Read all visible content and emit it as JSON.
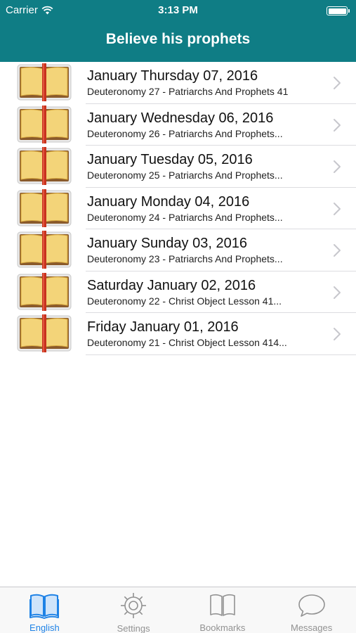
{
  "status_bar": {
    "carrier": "Carrier",
    "time": "3:13 PM"
  },
  "nav": {
    "title": "Believe his prophets"
  },
  "readings": [
    {
      "title": "January Thursday 07, 2016",
      "subtitle": "Deuteronomy 27  -  Patriarchs And Prophets 41"
    },
    {
      "title": "January Wednesday 06, 2016",
      "subtitle": "Deuteronomy 26  -  Patriarchs And Prophets..."
    },
    {
      "title": "January Tuesday 05, 2016",
      "subtitle": "Deuteronomy 25  -  Patriarchs And Prophets..."
    },
    {
      "title": "January Monday 04, 2016",
      "subtitle": "Deuteronomy 24  -  Patriarchs And Prophets..."
    },
    {
      "title": "January Sunday 03, 2016",
      "subtitle": "Deuteronomy 23  -  Patriarchs And Prophets..."
    },
    {
      "title": "Saturday January 02, 2016",
      "subtitle": "Deuteronomy 22  -  Christ Object Lesson 41..."
    },
    {
      "title": "Friday January 01, 2016",
      "subtitle": "Deuteronomy 21  -  Christ Object Lesson 414..."
    }
  ],
  "tabs": [
    {
      "label": "English",
      "icon": "book-icon",
      "active": true
    },
    {
      "label": "Settings",
      "icon": "gear-icon",
      "active": false
    },
    {
      "label": "Bookmarks",
      "icon": "bookmarks-book-icon",
      "active": false
    },
    {
      "label": "Messages",
      "icon": "speech-bubble-icon",
      "active": false
    }
  ],
  "colors": {
    "header": "#0f7d85",
    "accent": "#1e82e6",
    "tab_inactive": "#929292"
  }
}
